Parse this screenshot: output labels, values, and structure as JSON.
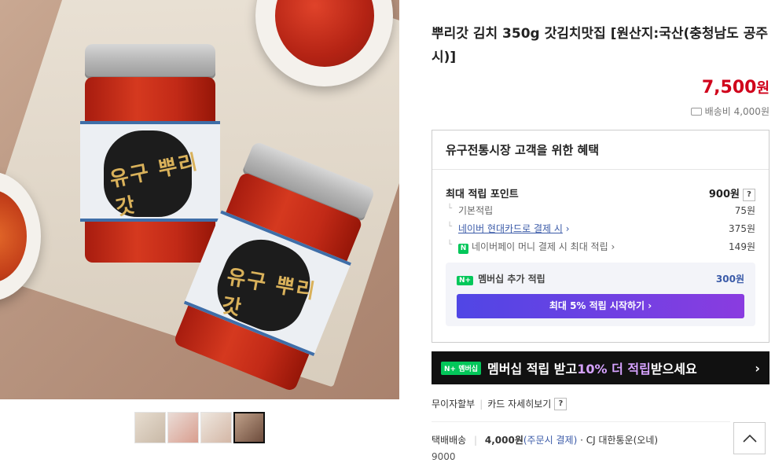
{
  "product": {
    "title": "뿌리갓 김치 350g 갓김치맛집 [원산지:국산(충청남도 공주시)]",
    "price_number": "7,500",
    "price_unit": "원",
    "shipping_label": "배송비 4,000원",
    "jar_logo": "유구 뿌리갓"
  },
  "thumbnails": [
    "thumb-1",
    "thumb-2",
    "thumb-3",
    "thumb-4"
  ],
  "benefit": {
    "heading": "유구전통시장 고객을 위한 혜택",
    "max_points_label": "최대 적립 포인트",
    "max_points_value": "900원",
    "help": "?",
    "rows": [
      {
        "label": "기본적립",
        "value": "75원"
      },
      {
        "label": "네이버 현대카드로 결제 시",
        "value": "375원"
      },
      {
        "label": "네이버페이 머니 결제 시 최대 적립",
        "value": "149원"
      }
    ],
    "member_badge": "N+",
    "member_label": "멤버십 추가 적립",
    "member_value": "300원",
    "member_button": "최대 5% 적립 시작하기 ›"
  },
  "banner": {
    "badge": "N+ 멤버십",
    "text_pre": "멤버십 적립 받고 ",
    "text_highlight": "10% 더 적립",
    "text_post": " 받으세요",
    "arrow": "›"
  },
  "links": {
    "installment": "무이자할부",
    "card_detail": "카드 자세히보기",
    "help": "?"
  },
  "delivery": {
    "label": "택배배송",
    "fee": "4,000원",
    "note": "(주문시 결제)",
    "carrier": "· CJ 대한통운(오네)",
    "extra": "9000"
  },
  "icons": {
    "truck": "truck-icon",
    "top": "chevron-up-icon",
    "npay": "naver-pay-icon"
  }
}
